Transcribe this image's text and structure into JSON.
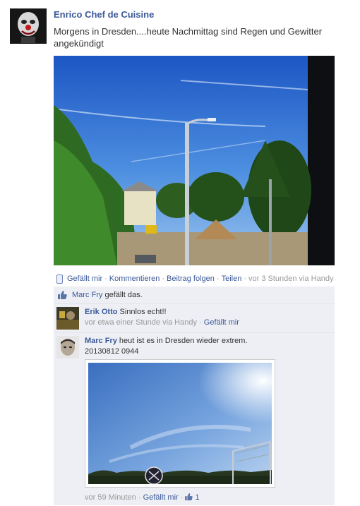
{
  "post": {
    "author": "Enrico Chef de Cuisine",
    "text": "Morgens in Dresden....heute Nachmittag sind Regen und Gewitter angekündigt"
  },
  "actions": {
    "like": "Gefällt mir",
    "comment": "Kommentieren",
    "follow": "Beitrag folgen",
    "share": "Teilen",
    "time": "vor 3 Stunden via Handy"
  },
  "likes": {
    "name": "Marc Fry",
    "suffix": "gefällt das."
  },
  "comments": [
    {
      "author": "Erik Otto",
      "text": "Sinnlos echt!!",
      "time": "vor etwa einer Stunde via Handy",
      "like": "Gefällt mir"
    },
    {
      "author": "Marc Fry",
      "text": "heut ist es in Dresden wieder extrem.",
      "text2": "20130812 0944",
      "time": "vor 59 Minuten",
      "like": "Gefällt mir",
      "like_count": "1"
    }
  ],
  "separator": "·",
  "icons": {
    "mobile": "mobile-phone-icon",
    "like": "thumbs-up-icon"
  },
  "colors": {
    "link": "#3b5998",
    "feedback_bg": "#edeff4",
    "meta": "#999999"
  }
}
